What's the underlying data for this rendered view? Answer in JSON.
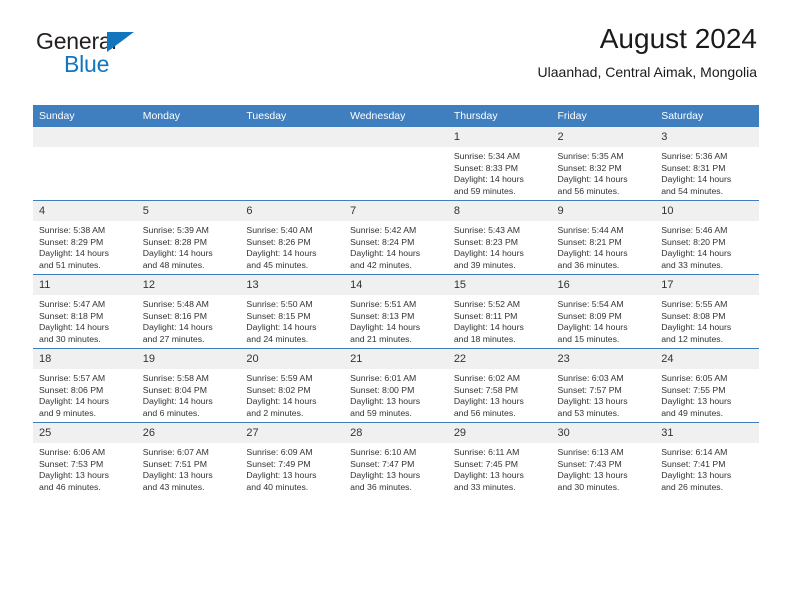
{
  "brand": {
    "name_top": "General",
    "name_bottom": "Blue",
    "triangle_color": "#1276bf"
  },
  "header": {
    "title": "August 2024",
    "subtitle": "Ulaanhad, Central Aimak, Mongolia",
    "accent_color": "#3f7fbf"
  },
  "calendar": {
    "weekdays": [
      "Sunday",
      "Monday",
      "Tuesday",
      "Wednesday",
      "Thursday",
      "Friday",
      "Saturday"
    ],
    "labels": {
      "sunrise": "Sunrise:",
      "sunset": "Sunset:",
      "daylight": "Daylight:"
    },
    "weeks": [
      [
        {
          "day": "",
          "sunrise": "",
          "sunset": "",
          "daylight_line1": "",
          "daylight_line2": ""
        },
        {
          "day": "",
          "sunrise": "",
          "sunset": "",
          "daylight_line1": "",
          "daylight_line2": ""
        },
        {
          "day": "",
          "sunrise": "",
          "sunset": "",
          "daylight_line1": "",
          "daylight_line2": ""
        },
        {
          "day": "",
          "sunrise": "",
          "sunset": "",
          "daylight_line1": "",
          "daylight_line2": ""
        },
        {
          "day": "1",
          "sunrise": "Sunrise: 5:34 AM",
          "sunset": "Sunset: 8:33 PM",
          "daylight_line1": "Daylight: 14 hours",
          "daylight_line2": "and 59 minutes."
        },
        {
          "day": "2",
          "sunrise": "Sunrise: 5:35 AM",
          "sunset": "Sunset: 8:32 PM",
          "daylight_line1": "Daylight: 14 hours",
          "daylight_line2": "and 56 minutes."
        },
        {
          "day": "3",
          "sunrise": "Sunrise: 5:36 AM",
          "sunset": "Sunset: 8:31 PM",
          "daylight_line1": "Daylight: 14 hours",
          "daylight_line2": "and 54 minutes."
        }
      ],
      [
        {
          "day": "4",
          "sunrise": "Sunrise: 5:38 AM",
          "sunset": "Sunset: 8:29 PM",
          "daylight_line1": "Daylight: 14 hours",
          "daylight_line2": "and 51 minutes."
        },
        {
          "day": "5",
          "sunrise": "Sunrise: 5:39 AM",
          "sunset": "Sunset: 8:28 PM",
          "daylight_line1": "Daylight: 14 hours",
          "daylight_line2": "and 48 minutes."
        },
        {
          "day": "6",
          "sunrise": "Sunrise: 5:40 AM",
          "sunset": "Sunset: 8:26 PM",
          "daylight_line1": "Daylight: 14 hours",
          "daylight_line2": "and 45 minutes."
        },
        {
          "day": "7",
          "sunrise": "Sunrise: 5:42 AM",
          "sunset": "Sunset: 8:24 PM",
          "daylight_line1": "Daylight: 14 hours",
          "daylight_line2": "and 42 minutes."
        },
        {
          "day": "8",
          "sunrise": "Sunrise: 5:43 AM",
          "sunset": "Sunset: 8:23 PM",
          "daylight_line1": "Daylight: 14 hours",
          "daylight_line2": "and 39 minutes."
        },
        {
          "day": "9",
          "sunrise": "Sunrise: 5:44 AM",
          "sunset": "Sunset: 8:21 PM",
          "daylight_line1": "Daylight: 14 hours",
          "daylight_line2": "and 36 minutes."
        },
        {
          "day": "10",
          "sunrise": "Sunrise: 5:46 AM",
          "sunset": "Sunset: 8:20 PM",
          "daylight_line1": "Daylight: 14 hours",
          "daylight_line2": "and 33 minutes."
        }
      ],
      [
        {
          "day": "11",
          "sunrise": "Sunrise: 5:47 AM",
          "sunset": "Sunset: 8:18 PM",
          "daylight_line1": "Daylight: 14 hours",
          "daylight_line2": "and 30 minutes."
        },
        {
          "day": "12",
          "sunrise": "Sunrise: 5:48 AM",
          "sunset": "Sunset: 8:16 PM",
          "daylight_line1": "Daylight: 14 hours",
          "daylight_line2": "and 27 minutes."
        },
        {
          "day": "13",
          "sunrise": "Sunrise: 5:50 AM",
          "sunset": "Sunset: 8:15 PM",
          "daylight_line1": "Daylight: 14 hours",
          "daylight_line2": "and 24 minutes."
        },
        {
          "day": "14",
          "sunrise": "Sunrise: 5:51 AM",
          "sunset": "Sunset: 8:13 PM",
          "daylight_line1": "Daylight: 14 hours",
          "daylight_line2": "and 21 minutes."
        },
        {
          "day": "15",
          "sunrise": "Sunrise: 5:52 AM",
          "sunset": "Sunset: 8:11 PM",
          "daylight_line1": "Daylight: 14 hours",
          "daylight_line2": "and 18 minutes."
        },
        {
          "day": "16",
          "sunrise": "Sunrise: 5:54 AM",
          "sunset": "Sunset: 8:09 PM",
          "daylight_line1": "Daylight: 14 hours",
          "daylight_line2": "and 15 minutes."
        },
        {
          "day": "17",
          "sunrise": "Sunrise: 5:55 AM",
          "sunset": "Sunset: 8:08 PM",
          "daylight_line1": "Daylight: 14 hours",
          "daylight_line2": "and 12 minutes."
        }
      ],
      [
        {
          "day": "18",
          "sunrise": "Sunrise: 5:57 AM",
          "sunset": "Sunset: 8:06 PM",
          "daylight_line1": "Daylight: 14 hours",
          "daylight_line2": "and 9 minutes."
        },
        {
          "day": "19",
          "sunrise": "Sunrise: 5:58 AM",
          "sunset": "Sunset: 8:04 PM",
          "daylight_line1": "Daylight: 14 hours",
          "daylight_line2": "and 6 minutes."
        },
        {
          "day": "20",
          "sunrise": "Sunrise: 5:59 AM",
          "sunset": "Sunset: 8:02 PM",
          "daylight_line1": "Daylight: 14 hours",
          "daylight_line2": "and 2 minutes."
        },
        {
          "day": "21",
          "sunrise": "Sunrise: 6:01 AM",
          "sunset": "Sunset: 8:00 PM",
          "daylight_line1": "Daylight: 13 hours",
          "daylight_line2": "and 59 minutes."
        },
        {
          "day": "22",
          "sunrise": "Sunrise: 6:02 AM",
          "sunset": "Sunset: 7:58 PM",
          "daylight_line1": "Daylight: 13 hours",
          "daylight_line2": "and 56 minutes."
        },
        {
          "day": "23",
          "sunrise": "Sunrise: 6:03 AM",
          "sunset": "Sunset: 7:57 PM",
          "daylight_line1": "Daylight: 13 hours",
          "daylight_line2": "and 53 minutes."
        },
        {
          "day": "24",
          "sunrise": "Sunrise: 6:05 AM",
          "sunset": "Sunset: 7:55 PM",
          "daylight_line1": "Daylight: 13 hours",
          "daylight_line2": "and 49 minutes."
        }
      ],
      [
        {
          "day": "25",
          "sunrise": "Sunrise: 6:06 AM",
          "sunset": "Sunset: 7:53 PM",
          "daylight_line1": "Daylight: 13 hours",
          "daylight_line2": "and 46 minutes."
        },
        {
          "day": "26",
          "sunrise": "Sunrise: 6:07 AM",
          "sunset": "Sunset: 7:51 PM",
          "daylight_line1": "Daylight: 13 hours",
          "daylight_line2": "and 43 minutes."
        },
        {
          "day": "27",
          "sunrise": "Sunrise: 6:09 AM",
          "sunset": "Sunset: 7:49 PM",
          "daylight_line1": "Daylight: 13 hours",
          "daylight_line2": "and 40 minutes."
        },
        {
          "day": "28",
          "sunrise": "Sunrise: 6:10 AM",
          "sunset": "Sunset: 7:47 PM",
          "daylight_line1": "Daylight: 13 hours",
          "daylight_line2": "and 36 minutes."
        },
        {
          "day": "29",
          "sunrise": "Sunrise: 6:11 AM",
          "sunset": "Sunset: 7:45 PM",
          "daylight_line1": "Daylight: 13 hours",
          "daylight_line2": "and 33 minutes."
        },
        {
          "day": "30",
          "sunrise": "Sunrise: 6:13 AM",
          "sunset": "Sunset: 7:43 PM",
          "daylight_line1": "Daylight: 13 hours",
          "daylight_line2": "and 30 minutes."
        },
        {
          "day": "31",
          "sunrise": "Sunrise: 6:14 AM",
          "sunset": "Sunset: 7:41 PM",
          "daylight_line1": "Daylight: 13 hours",
          "daylight_line2": "and 26 minutes."
        }
      ]
    ]
  }
}
